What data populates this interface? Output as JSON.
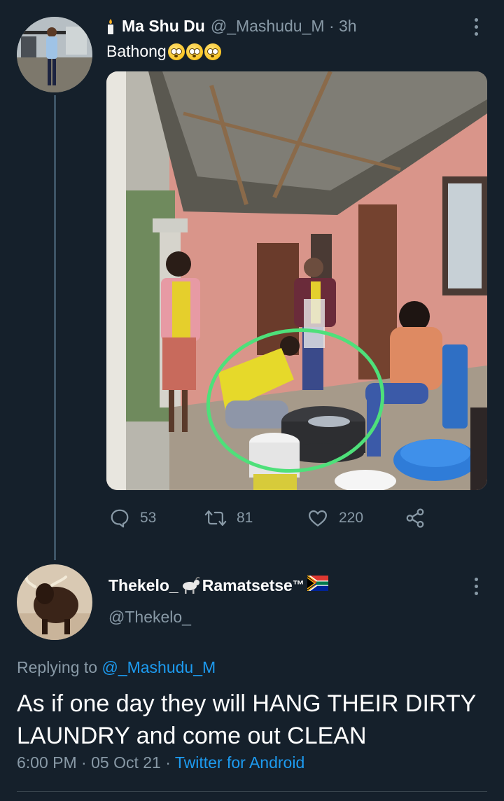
{
  "tweet": {
    "avatar_icon": "user-avatar-photo",
    "name_prefix_icon": "candle-icon",
    "display_name": "Ma Shu Du",
    "handle": "@_Mashudu_M",
    "separator": " · ",
    "time": "3h",
    "text": "Bathong",
    "emoji_icons": [
      "flushed-face-emoji",
      "flushed-face-emoji",
      "flushed-face-emoji"
    ],
    "menu_icon": "more-vertical-icon",
    "image_alt": "people washing clothes on a porch",
    "actions": {
      "reply_count": "53",
      "retweet_count": "81",
      "like_count": "220"
    }
  },
  "reply": {
    "avatar_icon": "bull-avatar",
    "name_part1": "Thekelo_",
    "name_goat_icon": "goat-emoji",
    "name_part2": "Ramatsetse",
    "name_tm": "™",
    "name_flag_icon": "south-africa-flag-emoji",
    "handle": "@Thekelo_",
    "menu_icon": "more-vertical-icon",
    "replying_to_label": "Replying to ",
    "replying_to_handle": "@_Mashudu_M",
    "text": "As if one day they will HANG THEIR DIRTY LAUNDRY and come out CLEAN",
    "time": "6:00 PM",
    "date_separator": " · ",
    "date": "05 Oct 21",
    "source_separator": " · ",
    "source": "Twitter for Android"
  },
  "colors": {
    "background": "#15202b",
    "muted": "#8899a6",
    "link": "#1d9bf0",
    "highlight_circle": "#4ee07a"
  }
}
